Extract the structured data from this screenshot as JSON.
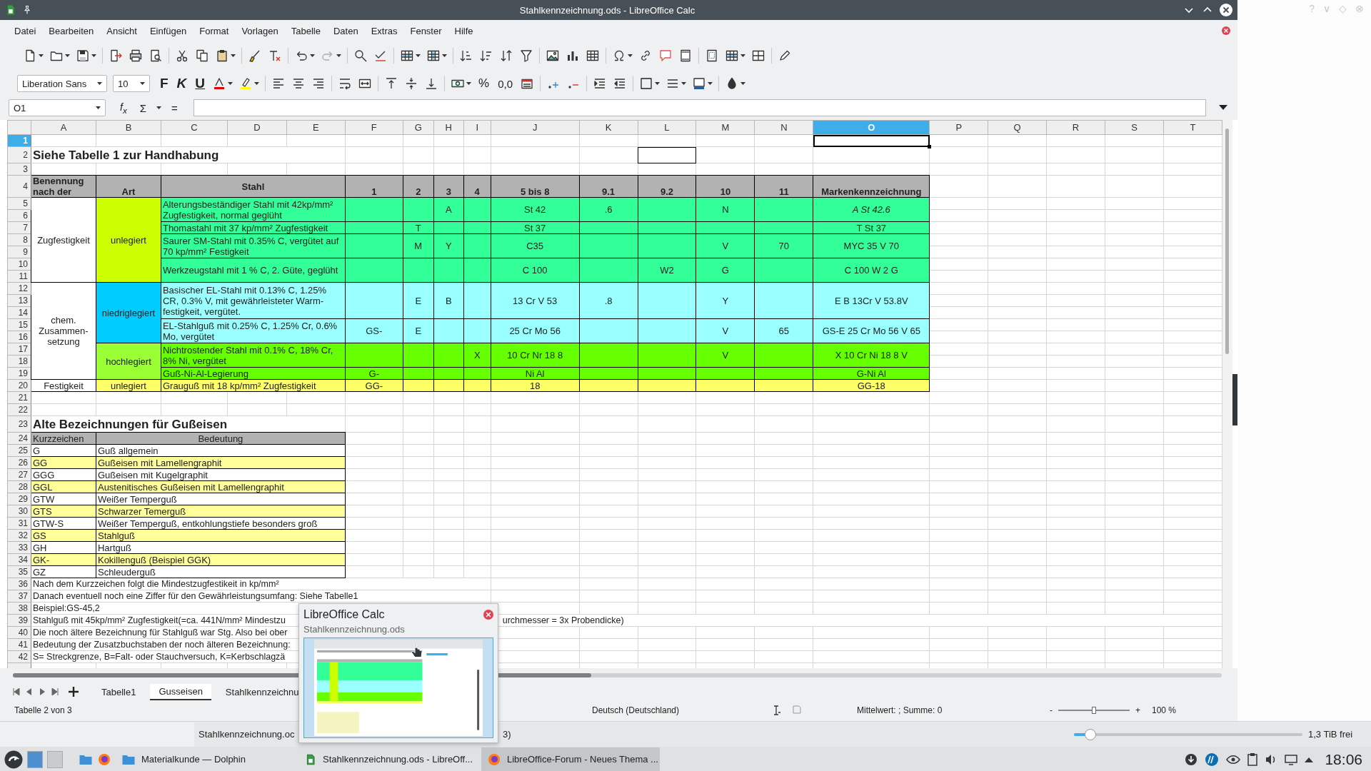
{
  "window": {
    "title": "Stahlkennzeichnung.ods - LibreOffice Calc"
  },
  "background_window": {
    "controls": [
      "?",
      "∨",
      "◇",
      "⊗"
    ]
  },
  "menu": [
    "Datei",
    "Bearbeiten",
    "Ansicht",
    "Einfügen",
    "Format",
    "Vorlagen",
    "Tabelle",
    "Daten",
    "Extras",
    "Fenster",
    "Hilfe"
  ],
  "formatting_toolbar": {
    "font_name": "Liberation Sans",
    "font_size": "10",
    "bold": "F",
    "italic": "K",
    "underline": "U",
    "percent": "%",
    "decimal": "0,0"
  },
  "formula_bar": {
    "cell_ref": "O1",
    "function_wizard": "f$_{x}$",
    "sum": "Σ",
    "equals": "="
  },
  "columns": [
    {
      "label": "A",
      "selected": false
    },
    {
      "label": "B",
      "selected": false
    },
    {
      "label": "C",
      "selected": false
    },
    {
      "label": "D",
      "selected": false
    },
    {
      "label": "E",
      "selected": false
    },
    {
      "label": "F",
      "selected": false
    },
    {
      "label": "G",
      "selected": false
    },
    {
      "label": "H",
      "selected": false
    },
    {
      "label": "I",
      "selected": false
    },
    {
      "label": "J",
      "selected": false
    },
    {
      "label": "K",
      "selected": false
    },
    {
      "label": "L",
      "selected": false
    },
    {
      "label": "M",
      "selected": false
    },
    {
      "label": "N",
      "selected": false
    },
    {
      "label": "O",
      "selected": true
    },
    {
      "label": "P",
      "selected": false
    },
    {
      "label": "Q",
      "selected": false
    },
    {
      "label": "R",
      "selected": false
    },
    {
      "label": "S",
      "selected": false
    },
    {
      "label": "T",
      "selected": false
    }
  ],
  "rows": [
    {
      "label": "1",
      "selected": true
    },
    {
      "label": "2",
      "selected": false
    },
    {
      "label": "3",
      "selected": false
    },
    {
      "label": "4",
      "selected": false
    },
    {
      "label": "5",
      "selected": false
    },
    {
      "label": "6",
      "selected": false
    },
    {
      "label": "7",
      "selected": false
    },
    {
      "label": "8",
      "selected": false
    },
    {
      "label": "9",
      "selected": false
    },
    {
      "label": "10",
      "selected": false
    },
    {
      "label": "11",
      "selected": false
    },
    {
      "label": "12",
      "selected": false
    },
    {
      "label": "13",
      "selected": false
    },
    {
      "label": "14",
      "selected": false
    },
    {
      "label": "15",
      "selected": false
    },
    {
      "label": "16",
      "selected": false
    },
    {
      "label": "17",
      "selected": false
    },
    {
      "label": "18",
      "selected": false
    },
    {
      "label": "19",
      "selected": false
    },
    {
      "label": "20",
      "selected": false
    },
    {
      "label": "21",
      "selected": false
    },
    {
      "label": "22",
      "selected": false
    },
    {
      "label": "23",
      "selected": false
    },
    {
      "label": "24",
      "selected": false
    },
    {
      "label": "25",
      "selected": false
    },
    {
      "label": "26",
      "selected": false
    },
    {
      "label": "27",
      "selected": false
    },
    {
      "label": "28",
      "selected": false
    },
    {
      "label": "29",
      "selected": false
    },
    {
      "label": "30",
      "selected": false
    },
    {
      "label": "31",
      "selected": false
    },
    {
      "label": "32",
      "selected": false
    },
    {
      "label": "33",
      "selected": false
    },
    {
      "label": "34",
      "selected": false
    },
    {
      "label": "35",
      "selected": false
    },
    {
      "label": "36",
      "selected": false
    },
    {
      "label": "37",
      "selected": false
    },
    {
      "label": "38",
      "selected": false
    },
    {
      "label": "39",
      "selected": false
    },
    {
      "label": "40",
      "selected": false
    },
    {
      "label": "41",
      "selected": false
    },
    {
      "label": "42",
      "selected": false
    }
  ],
  "steel_table": {
    "title": "Siehe Tabelle 1 zur Handhabung",
    "headers": [
      "Benennung nach der",
      "Art",
      "Stahl",
      "1",
      "2",
      "3",
      "4",
      "5 bis 8",
      "9.1",
      "9.2",
      "10",
      "11",
      "Markenkennzeichnung"
    ],
    "groups": [
      {
        "name": "Zugfestigkeit",
        "subgroups": [
          {
            "name": "unlegiert",
            "color": "#ccff00",
            "entries": [
              {
                "steel": "Alterungsbeständiger Stahl mit 42kp/mm² Zugfestigkeit, normal geglüht",
                "cells": {
                  "H": "A",
                  "J": "St 42",
                  "K": ".6",
                  "M": "N"
                },
                "mark": "A St 42.6",
                "mark_italic": true,
                "color": "#33ff99"
              },
              {
                "steel": "Thomastahl mit 37 kp/mm²  Zugfestigkeit",
                "cells": {
                  "G": "T",
                  "J": "St 37"
                },
                "mark": "T St 37",
                "mark_italic": false,
                "color": "#33ff99"
              },
              {
                "steel": "Saurer SM-Stahl mit 0.35% C, vergütet auf 70 kp/mm² Festigkeit",
                "cells": {
                  "G": "M",
                  "H": "Y",
                  "J": "C35",
                  "M": "V",
                  "N": "70"
                },
                "mark": "MYC 35 V 70",
                "mark_italic": false,
                "color": "#33ff99"
              },
              {
                "steel": "Werkzeugstahl mit 1 % C, 2. Güte, geglüht",
                "cells": {
                  "J": "C 100",
                  "L": "W2",
                  "M": "G"
                },
                "mark": "C 100 W 2 G",
                "mark_italic": false,
                "color": "#33ff99"
              }
            ]
          }
        ]
      },
      {
        "name": "chem. Zusammen-setzung",
        "subgroups": [
          {
            "name": "niedriglegiert",
            "color": "#00ccff",
            "entries": [
              {
                "steel": "Basischer EL-Stahl mit 0.13% C, 1.25% CR, 0.3% V, mit gewährleisteter Warm-festigkeit, vergütet.",
                "cells": {
                  "G": "E",
                  "H": "B",
                  "J": "13 Cr V 53",
                  "K": ".8",
                  "M": "Y"
                },
                "mark": "E B 13Cr V 53.8V",
                "mark_italic": false,
                "color": "#99ffff"
              },
              {
                "steel": "EL-Stahlguß mit 0.25% C, 1.25% Cr, 0.6% Mo, vergütet",
                "cells": {
                  "F": "GS-",
                  "G": "E",
                  "J": "25 Cr Mo 56",
                  "M": "V",
                  "N": "65"
                },
                "mark": "GS-E 25 Cr Mo 56  V 65",
                "mark_italic": false,
                "color": "#99ffff"
              }
            ]
          },
          {
            "name": "hochlegiert",
            "color": "#99ff33",
            "entries": [
              {
                "steel": "Nichtrostender Stahl mit 0.1% C, 18% Cr, 8% Ni, vergütet",
                "cells": {
                  "I": "X",
                  "J": "10 Cr Nr 18 8",
                  "M": "V"
                },
                "mark": "X 10 Cr Ni 18 8 V",
                "mark_italic": false,
                "color": "#66ff00"
              },
              {
                "steel": "Guß-Ni-Al-Legierung",
                "cells": {
                  "F": "G-",
                  "J": "Ni Al"
                },
                "mark": "G-Ni Al",
                "mark_italic": false,
                "color": "#66ff00"
              }
            ]
          }
        ]
      },
      {
        "name": "Festigkeit",
        "subgroups": [
          {
            "name": "unlegiert",
            "color": "#ffff66",
            "entries": [
              {
                "steel": "Grauguß mit 18 kp/mm² Zugfestigkeit",
                "cells": {
                  "F": "GG-",
                  "J": "18"
                },
                "mark": "GG-18",
                "mark_italic": false,
                "color": "#ffff66"
              }
            ]
          }
        ]
      }
    ]
  },
  "cast_iron_table": {
    "title": "Alte Bezeichnungen für Gußeisen",
    "headers": [
      "Kurzzeichen",
      "Bedeutung"
    ],
    "rows": [
      {
        "code": "G",
        "meaning": "Guß allgemein",
        "highlighted": false
      },
      {
        "code": "GG",
        "meaning": "Gußeisen mit Lamellengraphit",
        "highlighted": true
      },
      {
        "code": "GGG",
        "meaning": "Gußeisen mit Kugelgraphit",
        "highlighted": false
      },
      {
        "code": "GGL",
        "meaning": "Austenitisches Gußeisen mit Lamellengraphit",
        "highlighted": true
      },
      {
        "code": "GTW",
        "meaning": "Weißer Temperguß",
        "highlighted": false
      },
      {
        "code": "GTS",
        "meaning": "Schwarzer Temerguß",
        "highlighted": true
      },
      {
        "code": "GTW-S",
        "meaning": "Weißer Temperguß, entkohlungstiefe besonders groß",
        "highlighted": false
      },
      {
        "code": "GS",
        "meaning": "Stahlguß",
        "highlighted": true
      },
      {
        "code": "GH",
        "meaning": "Hartguß",
        "highlighted": false
      },
      {
        "code": "GK-",
        "meaning": "Kokillenguß (Beispiel GGK)",
        "highlighted": true
      },
      {
        "code": "GZ",
        "meaning": "Schleuderguß",
        "highlighted": false
      }
    ]
  },
  "notes": [
    {
      "text": "Nach dem Kurzzeichen folgt die Mindestzugfestikeit in kp/mm²"
    },
    {
      "text": "Danach eventuell noch eine Ziffer für den Gewährleistungsumfang: Siehe Tabelle1"
    },
    {
      "text": "Beispiel:GS-45,2"
    },
    {
      "text": "Stahlguß mit 45kp/mm² Zugfestigkeit(=ca. 441N/mm² Mindestzu",
      "continuation": "urchmesser = 3x Probendicke)"
    },
    {
      "text": "Die noch ältere Bezeichnung für Stahlguß war Stg. Also bei ober"
    },
    {
      "text": "Bedeutung der Zusatzbuchstaben der noch älteren Bezeichnung:"
    },
    {
      "text": "S= Streckgrenze, B=Falt- oder Stauchversuch, K=Kerbschlagzä"
    }
  ],
  "sheet_tabs": [
    {
      "label": "Tabelle1",
      "selected": false
    },
    {
      "label": "Gusseisen",
      "selected": true
    },
    {
      "label": "Stahlkennzeichnu",
      "selected": false
    }
  ],
  "status_bar": {
    "sheet_info": "Tabelle 2 von 3",
    "language": "Deutsch (Deutschland)",
    "summary": "Mittelwert: ; Summe: 0",
    "zoom": {
      "minus": "-",
      "plus": "+",
      "level": 0.5,
      "value": "100 %"
    }
  },
  "task_preview": {
    "title": "LibreOffice Calc",
    "subtitle": "Stahlkennzeichnung.ods"
  },
  "panel": {
    "label": "Stahlkennzeichnung.oc",
    "label_2": "3)",
    "storage": {
      "level": 0.05,
      "reading": "1,3 TiB frei"
    }
  },
  "taskbar": {
    "tasks": [
      {
        "title": "Materialkunde — Dolphin",
        "kind": "folder",
        "selected": false
      },
      {
        "title": "Stahlkennzeichnung.ods - LibreOff...",
        "kind": "spreadsheet",
        "selected": false
      },
      {
        "title": "LibreOffice-Forum - Neues Thema ...",
        "kind": "browser",
        "selected": true
      }
    ],
    "clock": "18:06"
  }
}
